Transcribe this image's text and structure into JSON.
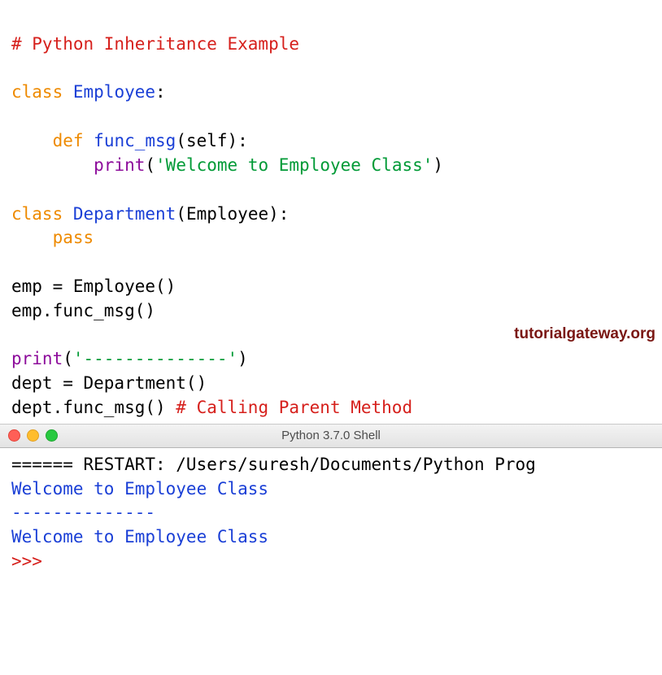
{
  "code": {
    "line1_comment": "# Python Inheritance Example",
    "kw_class1": "class",
    "name_employee": "Employee",
    "colon": ":",
    "kw_def": "def",
    "func_name": "func_msg",
    "def_sig_tail": "(self):",
    "bi_print1": "print",
    "open_paren": "(",
    "str_welcome": "'Welcome to Employee Class'",
    "close_paren": ")",
    "kw_class2": "class",
    "name_department": "Department",
    "dept_parent": "(Employee):",
    "kw_pass": "pass",
    "emp_assign": "emp = Employee()",
    "emp_call": "emp.func_msg()",
    "bi_print2": "print",
    "str_dashes": "'--------------'",
    "dept_assign": "dept = Department()",
    "dept_call": "dept.func_msg() ",
    "comment_call": "# Calling Parent Method"
  },
  "watermark": "tutorialgateway.org",
  "shell": {
    "title": "Python 3.7.0 Shell",
    "restart": "====== RESTART: /Users/suresh/Documents/Python Prog",
    "out1": "Welcome to Employee Class",
    "out2": "--------------",
    "out3": "Welcome to Employee Class",
    "prompt": ">>> "
  }
}
